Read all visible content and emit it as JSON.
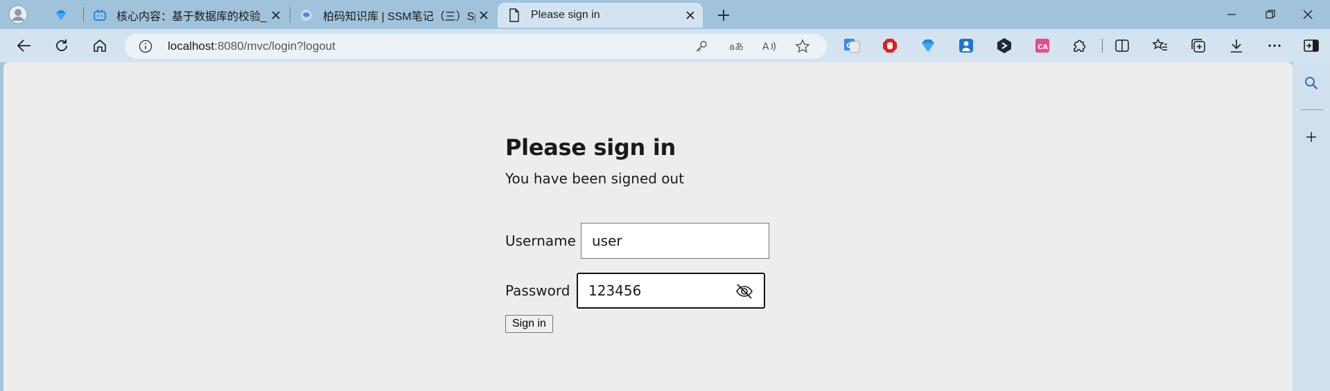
{
  "tabs": [
    {
      "title": "",
      "icon": "diamond-favicon"
    },
    {
      "title": "核心内容：基于数据库的校验_哔",
      "icon": "bilibili-favicon"
    },
    {
      "title": "柏码知识库 | SSM笔记（三）Spri",
      "icon": "itbaima-favicon"
    },
    {
      "title": "Please sign in",
      "icon": "page-icon"
    }
  ],
  "address": {
    "host": "localhost",
    "rest": ":8080/mvc/login?logout"
  },
  "login": {
    "heading": "Please sign in",
    "message": "You have been signed out",
    "username_label": "Username",
    "username_value": "user",
    "password_label": "Password",
    "password_value": "123456",
    "submit_label": "Sign in"
  },
  "colors": {
    "tabstrip": "#a0c3db",
    "toolbar": "#d3e4f0",
    "page": "#ededed"
  }
}
